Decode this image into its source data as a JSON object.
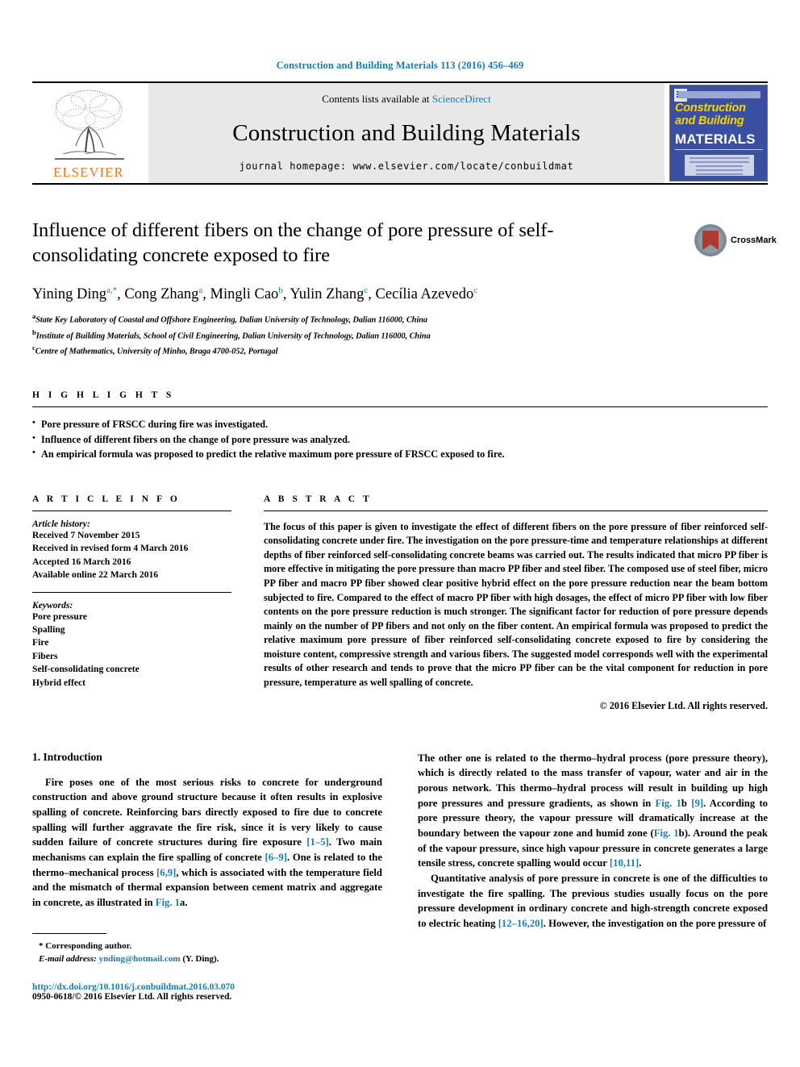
{
  "running_head": "Construction and Building Materials 113 (2016) 456–469",
  "masthead": {
    "publisher_name": "ELSEVIER",
    "contents_prefix": "Contents lists available at ",
    "contents_link": "ScienceDirect",
    "journal_name": "Construction and Building Materials",
    "homepage": "journal homepage: www.elsevier.com/locate/conbuildmat",
    "cover": {
      "line1": "Construction",
      "line2": "and Building",
      "line3": "MATERIALS"
    }
  },
  "title": "Influence of different fibers on the change of pore pressure of self-consolidating concrete exposed to fire",
  "crossmark_label": "CrossMark",
  "authors": [
    {
      "name": "Yining Ding",
      "marks": "a,*"
    },
    {
      "name": "Cong Zhang",
      "marks": "a"
    },
    {
      "name": "Mingli Cao",
      "marks": "b"
    },
    {
      "name": "Yulin Zhang",
      "marks": "c"
    },
    {
      "name": "Cecília Azevedo",
      "marks": "c"
    }
  ],
  "affiliations": [
    {
      "mark": "a",
      "text": "State Key Laboratory of Coastal and Offshore Engineering, Dalian University of Technology, Dalian 116000, China"
    },
    {
      "mark": "b",
      "text": "Institute of Building Materials, School of Civil Engineering, Dalian University of Technology, Dalian 116000, China"
    },
    {
      "mark": "c",
      "text": "Centre of Mathematics, University of Minho, Braga 4700-052, Portugal"
    }
  ],
  "highlights": {
    "heading": "H I G H L I G H T S",
    "items": [
      "Pore pressure of FRSCC during fire was investigated.",
      "Influence of different fibers on the change of pore pressure was analyzed.",
      "An empirical formula was proposed to predict the relative maximum pore pressure of FRSCC exposed to fire."
    ]
  },
  "article_info": {
    "heading": "A R T I C L E   I N F O",
    "history_label": "Article history:",
    "history": [
      "Received 7 November 2015",
      "Received in revised form 4 March 2016",
      "Accepted 16 March 2016",
      "Available online 22 March 2016"
    ],
    "keywords_label": "Keywords:",
    "keywords": [
      "Pore pressure",
      "Spalling",
      "Fire",
      "Fibers",
      "Self-consolidating concrete",
      "Hybrid effect"
    ]
  },
  "abstract": {
    "heading": "A B S T R A C T",
    "text": "The focus of this paper is given to investigate the effect of different fibers on the pore pressure of fiber reinforced self-consolidating concrete under fire. The investigation on the pore pressure-time and temperature relationships at different depths of fiber reinforced self-consolidating concrete beams was carried out. The results indicated that micro PP fiber is more effective in mitigating the pore pressure than macro PP fiber and steel fiber. The composed use of steel fiber, micro PP fiber and macro PP fiber showed clear positive hybrid effect on the pore pressure reduction near the beam bottom subjected to fire. Compared to the effect of macro PP fiber with high dosages, the effect of micro PP fiber with low fiber contents on the pore pressure reduction is much stronger. The significant factor for reduction of pore pressure depends mainly on the number of PP fibers and not only on the fiber content. An empirical formula was proposed to predict the relative maximum pore pressure of fiber reinforced self-consolidating concrete exposed to fire by considering the moisture content, compressive strength and various fibers. The suggested model corresponds well with the experimental results of other research and tends to prove that the micro PP fiber can be the vital component for reduction in pore pressure, temperature as well spalling of concrete.",
    "copyright": "© 2016 Elsevier Ltd. All rights reserved."
  },
  "introduction": {
    "heading": "1. Introduction",
    "left_p1_a": "Fire poses one of the most serious risks to concrete for underground construction and above ground structure because it often results in explosive spalling of concrete. Reinforcing bars directly exposed to fire due to concrete spalling will further aggravate the fire risk, since it is very likely to cause sudden failure of concrete structures during fire exposure ",
    "ref_1_5": "[1–5]",
    "left_p1_b": ". Two main mechanisms can explain the fire spalling of concrete ",
    "ref_6_9": "[6–9]",
    "left_p1_c": ". One is related to the thermo–mechanical process ",
    "ref_69": "[6,9]",
    "left_p1_d": ", which is associated with the temperature field and the mismatch of thermal expansion between cement matrix and aggregate in concrete, as illustrated in ",
    "fig_1a": "Fig. 1",
    "left_p1_e": "a.",
    "right_p1_a": "The other one is related to the thermo–hydral process (pore pressure theory), which is directly related to the mass transfer of vapour, water and air in the porous network. This thermo–hydral process will result in building up high pore pressures and pressure gradients, as shown in ",
    "fig_1b": "Fig. 1",
    "right_p1_b": "b ",
    "ref_9": "[9]",
    "right_p1_c": ". According to pore pressure theory, the vapour pressure will dramatically increase at the boundary between the vapour zone and humid zone (",
    "fig_1b2": "Fig. 1",
    "right_p1_d": "b). Around the peak of the vapour pressure, since high vapour pressure in concrete generates a large tensile stress, concrete spalling would occur ",
    "ref_10_11": "[10,11]",
    "right_p1_e": ".",
    "right_p2_a": "Quantitative analysis of pore pressure in concrete is one of the difficulties to investigate the fire spalling. The previous studies usually focus on the pore pressure development in ordinary concrete and high-strength concrete exposed to electric heating ",
    "ref_12_16_20": "[12–16,20]",
    "right_p2_b": ". However, the investigation on the pore pressure of"
  },
  "footnote": {
    "corresponding": "* Corresponding author.",
    "email_label": "E-mail address:",
    "email": "ynding@hotmail.com",
    "email_suffix": "(Y. Ding).",
    "doi": "http://dx.doi.org/10.1016/j.conbuildmat.2016.03.070",
    "issn": "0950-0618/© 2016 Elsevier Ltd. All rights reserved."
  },
  "colors": {
    "link": "#1a7bb0",
    "elsevier_orange": "#E87722",
    "cover_blue": "#3b4fa0"
  }
}
